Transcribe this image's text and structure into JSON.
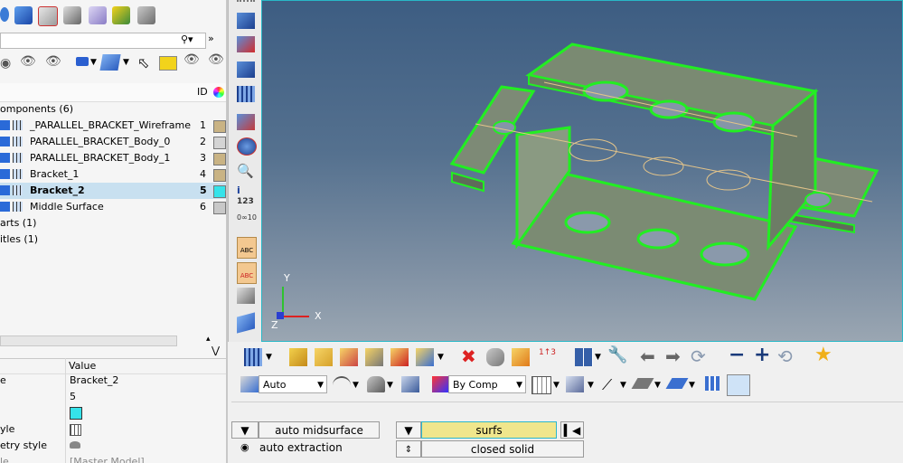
{
  "left_panel": {
    "search_placeholder": "",
    "id_header": "ID",
    "tree": [
      {
        "label": "omponents (6)",
        "level": 0
      },
      {
        "label": "_PARALLEL_BRACKET_Wireframe",
        "id": "1",
        "color": "#c9b384"
      },
      {
        "label": "PARALLEL_BRACKET_Body_0",
        "id": "2",
        "color": "#d4d4d4"
      },
      {
        "label": "PARALLEL_BRACKET_Body_1",
        "id": "3",
        "color": "#c9b384"
      },
      {
        "label": "Bracket_1",
        "id": "4",
        "color": "#c9b384"
      },
      {
        "label": "Bracket_2",
        "id": "5",
        "color": "#35e3ea",
        "selected": true
      },
      {
        "label": "Middle Surface",
        "id": "6",
        "color": "#c8c8c8"
      },
      {
        "label": "arts (1)",
        "level": 0
      },
      {
        "label": "itles (1)",
        "level": 0
      }
    ],
    "props_header": {
      "name": "",
      "value": "Value"
    },
    "props": [
      {
        "name": "e",
        "value": "Bracket_2"
      },
      {
        "name": "",
        "value": "5"
      },
      {
        "name": "",
        "value": "",
        "swatch": "#35e3ea"
      },
      {
        "name": "yle",
        "value": "",
        "icon": "mesh-style-icon"
      },
      {
        "name": "etry style",
        "value": "",
        "icon": "geometry-style-icon"
      },
      {
        "name": "le",
        "value": "[Master Model]"
      }
    ]
  },
  "viewport": {
    "background_top": "#3d5d82",
    "background_bottom": "#9aa6b2",
    "highlight_color": "#22ee22",
    "axis_y": "Y",
    "axis_x": "X",
    "axis_z": "Z"
  },
  "toolbar2": {
    "display_mode": "Auto",
    "color_mode": "By Comp"
  },
  "panel": {
    "mode_button": "auto midsurface",
    "entity_selector": "surfs",
    "option_radio": "auto extraction",
    "target_toggle": "closed solid",
    "surfs_color": "#f0e68c"
  }
}
